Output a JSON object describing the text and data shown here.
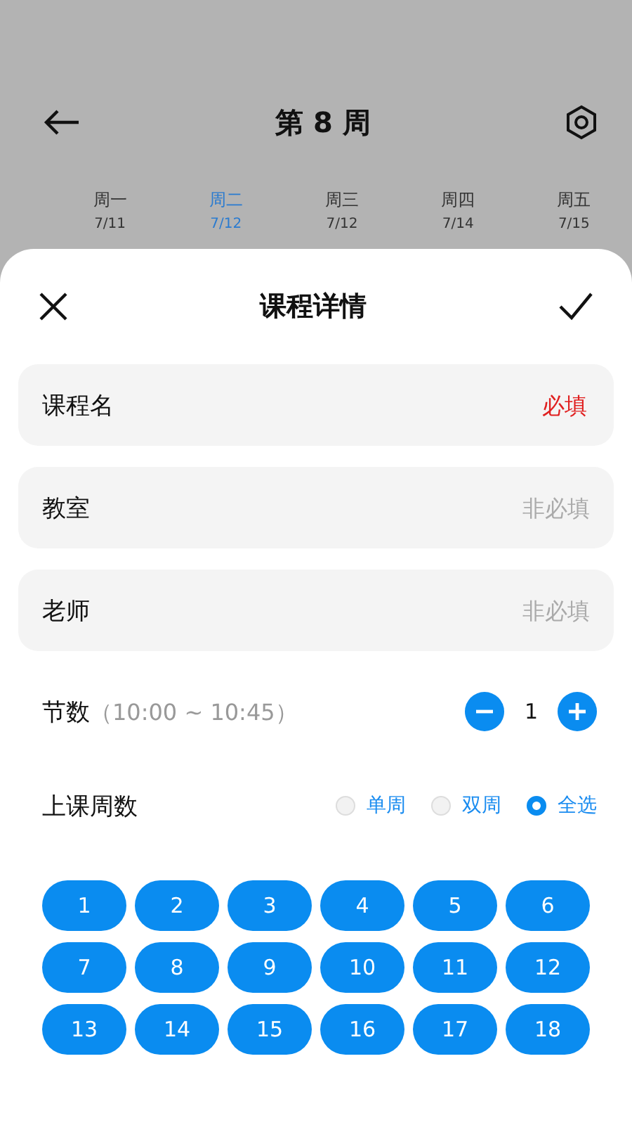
{
  "top_bar": {
    "title": "第 8 周"
  },
  "days": [
    {
      "label": "周一",
      "date": "7/11",
      "selected": false
    },
    {
      "label": "周二",
      "date": "7/12",
      "selected": true
    },
    {
      "label": "周三",
      "date": "7/12",
      "selected": false
    },
    {
      "label": "周四",
      "date": "7/14",
      "selected": false
    },
    {
      "label": "周五",
      "date": "7/15",
      "selected": false
    }
  ],
  "sheet": {
    "title": "课程详情"
  },
  "fields": [
    {
      "label": "课程名",
      "placeholder": "必填",
      "required": true
    },
    {
      "label": "教室",
      "placeholder": "非必填",
      "required": false
    },
    {
      "label": "老师",
      "placeholder": "非必填",
      "required": false
    }
  ],
  "periods": {
    "label": "节数",
    "time": "（10:00 ~ 10:45）",
    "value": "1"
  },
  "weeks": {
    "label": "上课周数",
    "options": [
      {
        "label": "单周",
        "selected": false
      },
      {
        "label": "双周",
        "selected": false
      },
      {
        "label": "全选",
        "selected": true
      }
    ],
    "items": [
      {
        "label": "1",
        "selected": true
      },
      {
        "label": "2",
        "selected": true
      },
      {
        "label": "3",
        "selected": true
      },
      {
        "label": "4",
        "selected": true
      },
      {
        "label": "5",
        "selected": true
      },
      {
        "label": "6",
        "selected": true
      },
      {
        "label": "7",
        "selected": true
      },
      {
        "label": "8",
        "selected": true
      },
      {
        "label": "9",
        "selected": true
      },
      {
        "label": "10",
        "selected": true
      },
      {
        "label": "11",
        "selected": true
      },
      {
        "label": "12",
        "selected": true
      },
      {
        "label": "13",
        "selected": true
      },
      {
        "label": "14",
        "selected": true
      },
      {
        "label": "15",
        "selected": true
      },
      {
        "label": "16",
        "selected": true
      },
      {
        "label": "17",
        "selected": true
      },
      {
        "label": "18",
        "selected": true
      }
    ]
  }
}
